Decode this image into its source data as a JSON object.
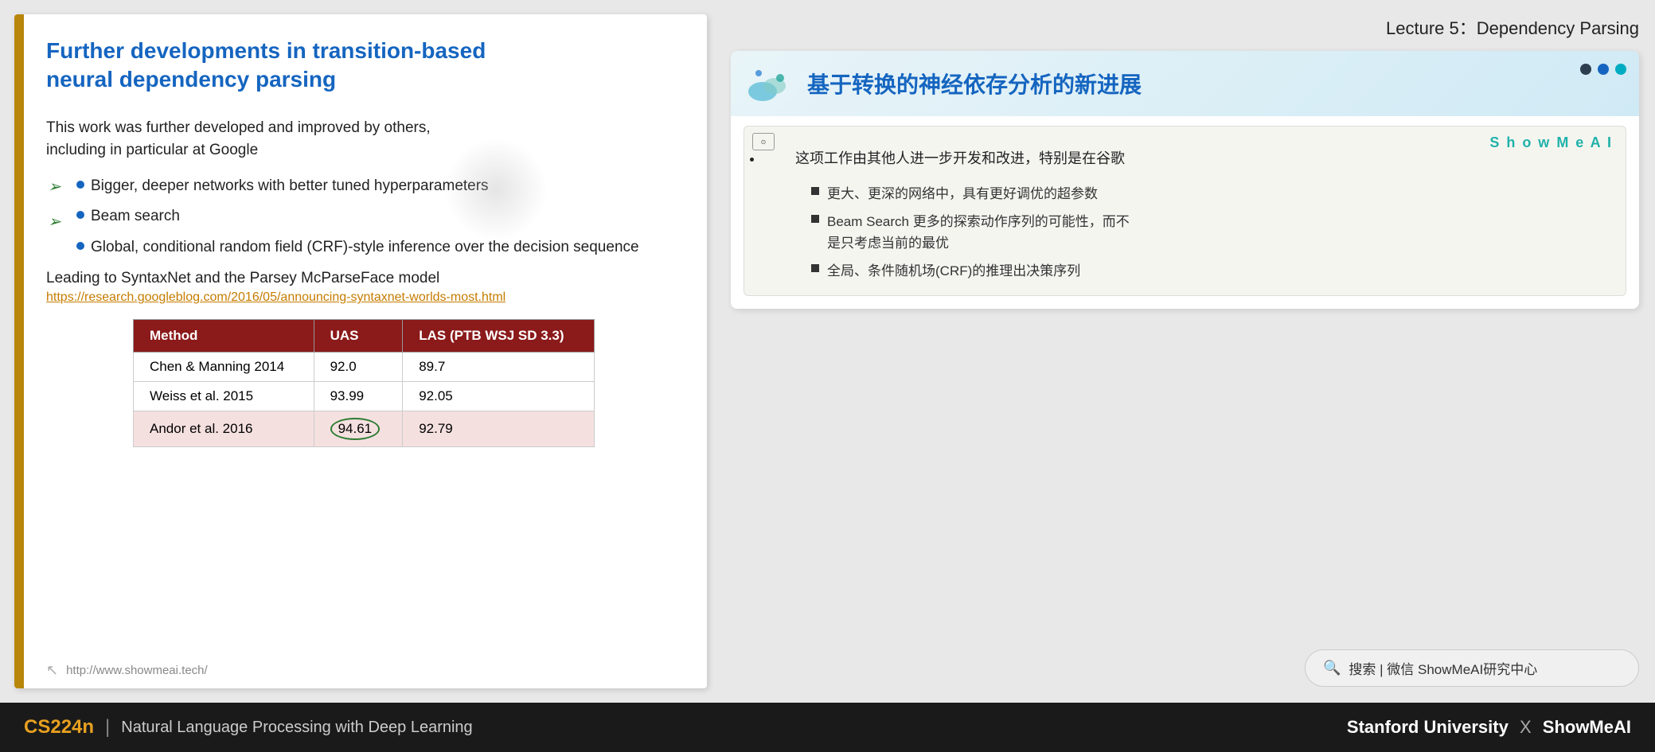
{
  "lecture": {
    "header": "Lecture 5：Dependency Parsing"
  },
  "slide": {
    "title": "Further developments in transition-based\nneural dependency parsing",
    "body_intro": "This work was further developed and improved by others,\nincluding in particular at Google",
    "bullets": [
      "Bigger, deeper networks with better tuned hyperparameters",
      "Beam search",
      "Global, conditional random field (CRF)-style inference over\nthe decision sequence"
    ],
    "leading": "Leading to SyntaxNet and the Parsey McParseFace model",
    "link": "https://research.googleblog.com/2016/05/announcing-syntaxnet-worlds-most.html",
    "table": {
      "headers": [
        "Method",
        "UAS",
        "LAS (PTB WSJ SD 3.3)"
      ],
      "rows": [
        [
          "Chen & Manning 2014",
          "92.0",
          "89.7"
        ],
        [
          "Weiss et al. 2015",
          "93.99",
          "92.05"
        ],
        [
          "Andor et al. 2016",
          "94.61",
          "92.79"
        ]
      ]
    },
    "footer_url": "http://www.showmeai.tech/"
  },
  "chinese_card": {
    "title": "基于转换的神经依存分析的新进展",
    "showmeai_label": "S h o w M e A I",
    "bullets": [
      {
        "main": "这项工作由其他人进一步开发和改进，特别是在谷歌",
        "subs": [
          "更大、更深的网络中，具有更好调优的超参数",
          "Beam Search 更多的探索动作序列的可能性，而不\n是只考虑当前的最优",
          "全局、条件随机场(CRF)的推理出决策序列"
        ]
      }
    ]
  },
  "search": {
    "text": "搜索 | 微信 ShowMeAI研究中心"
  },
  "bottom_bar": {
    "course": "CS224n",
    "divider": "|",
    "subtitle": "Natural Language Processing with Deep Learning",
    "right": "Stanford University",
    "x": "✕",
    "brand": "ShowMeAI"
  }
}
